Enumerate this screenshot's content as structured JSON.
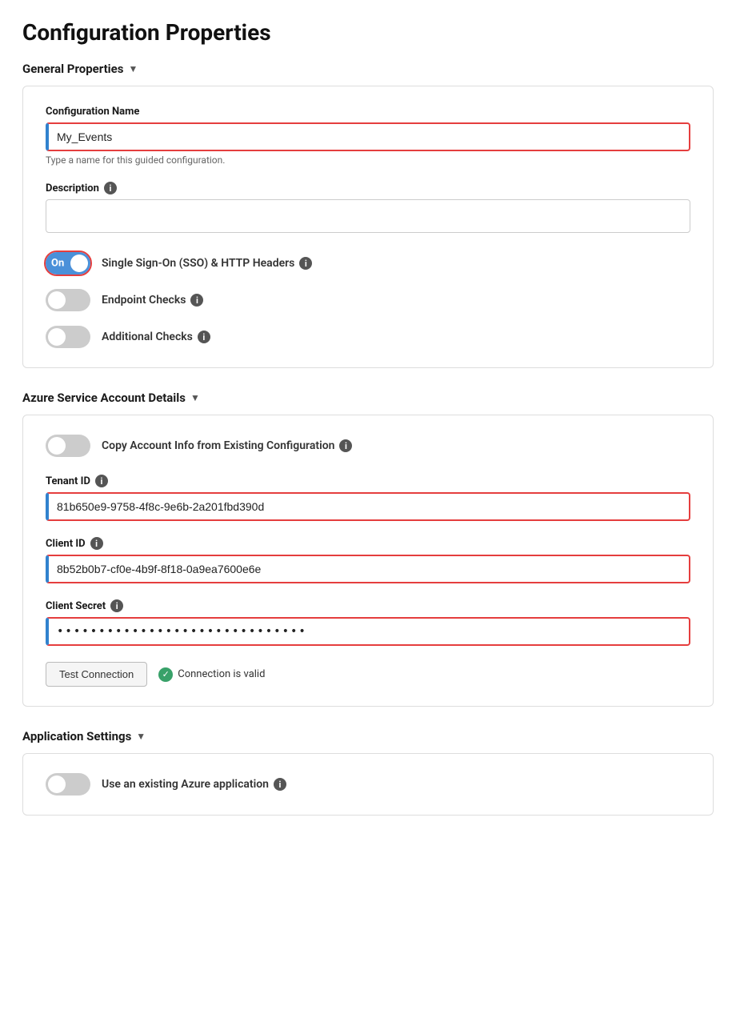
{
  "page": {
    "title": "Configuration Properties"
  },
  "general_properties": {
    "header": "General Properties",
    "config_name_label": "Configuration Name",
    "config_name_value": "My_Events",
    "config_name_hint": "Type a name for this guided configuration.",
    "description_label": "Description",
    "description_value": "",
    "sso_label": "Single Sign-On (SSO) & HTTP Headers",
    "sso_toggle_on": true,
    "sso_toggle_text": "On",
    "endpoint_label": "Endpoint Checks",
    "endpoint_toggle_on": false,
    "additional_label": "Additional Checks",
    "additional_toggle_on": false
  },
  "azure_details": {
    "header": "Azure Service Account Details",
    "copy_label": "Copy Account Info from Existing Configuration",
    "copy_toggle_on": false,
    "tenant_id_label": "Tenant ID",
    "tenant_id_value": "81b650e9-9758-4f8c-9e6b-2a201fbd390d",
    "client_id_label": "Client ID",
    "client_id_value": "8b52b0b7-cf0e-4b9f-8f18-0a9ea7600e6e",
    "client_secret_label": "Client Secret",
    "client_secret_value": "••••••••••••••••••••••••••••••",
    "test_btn_label": "Test Connection",
    "connection_valid_text": "Connection is valid"
  },
  "app_settings": {
    "header": "Application Settings",
    "use_existing_label": "Use an existing Azure application",
    "use_existing_toggle_on": false
  },
  "icons": {
    "info": "i",
    "check": "✓",
    "arrow_down": "▼"
  }
}
